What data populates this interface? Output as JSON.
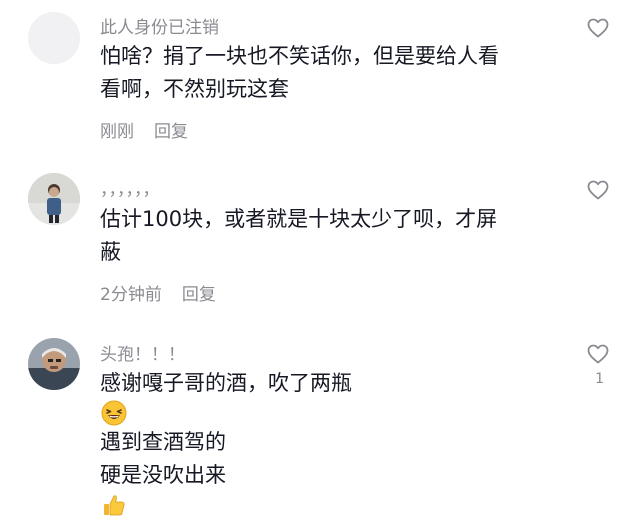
{
  "comments": [
    {
      "username": "此人身份已注销",
      "lines": [
        "怕啥？捐了一块也不笑话你，但是要给人看",
        "看啊，不然别玩这套"
      ],
      "time": "刚刚",
      "reply": "回复"
    },
    {
      "username": "，，，，，，",
      "lines": [
        "估计100块，或者就是十块太少了呗，才屏",
        "蔽"
      ],
      "time": "2分钟前",
      "reply": "回复"
    },
    {
      "username": "头孢！！！",
      "line1_a": "感谢嘎子哥的酒，吹了两瓶",
      "line1_b": "遇到查酒驾的",
      "line2": "硬是没吹出来",
      "like_count": "1"
    }
  ],
  "icons": {
    "like": "heart-outline-icon",
    "emoji1": "grinning-squint-emoji",
    "emoji2": "thumbs-up-emoji"
  },
  "colors": {
    "text": "#161823",
    "muted": "#8a8b91",
    "background": "#ffffff"
  }
}
